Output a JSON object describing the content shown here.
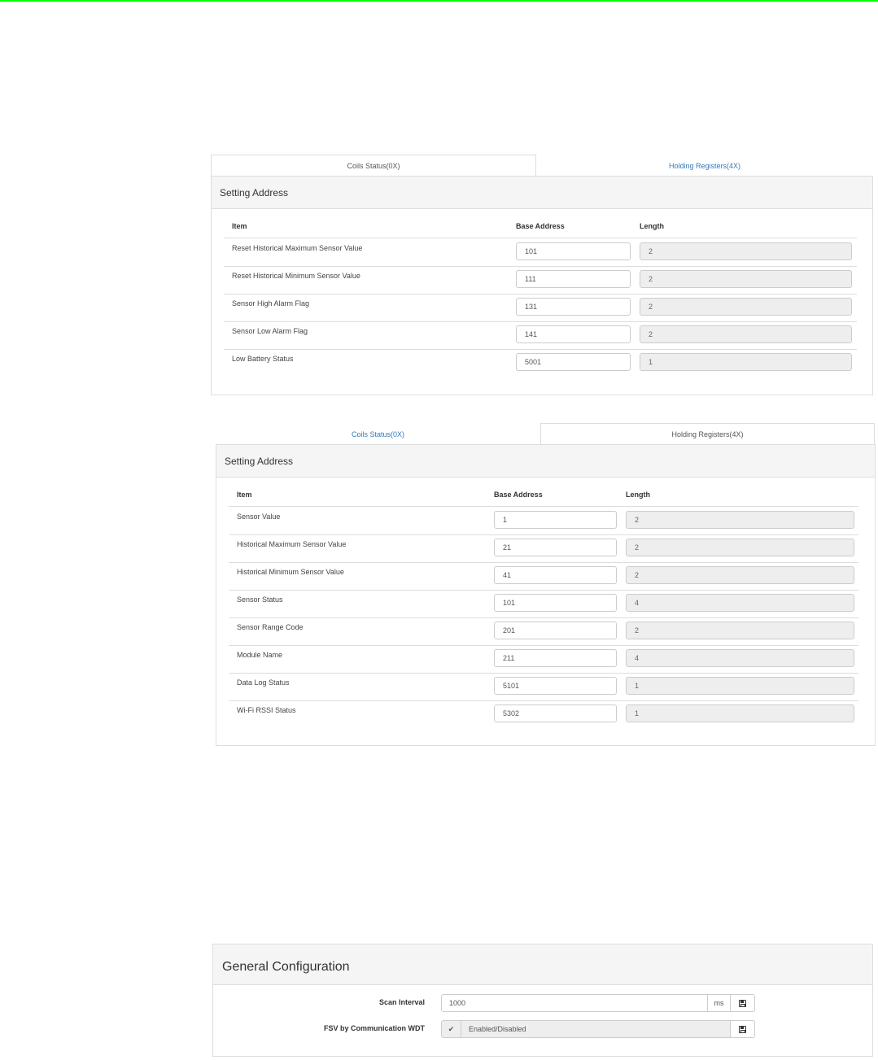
{
  "coils_view": {
    "tabs": [
      {
        "label": "Coils Status(0X)",
        "active": true
      },
      {
        "label": "Holding Registers(4X)",
        "active": false
      }
    ],
    "panel_title": "Setting Address",
    "columns": {
      "item": "Item",
      "base_address": "Base Address",
      "length": "Length"
    },
    "rows": [
      {
        "item": "Reset Historical Maximum Sensor Value",
        "base_address": "101",
        "length": "2"
      },
      {
        "item": "Reset Historical Minimum Sensor Value",
        "base_address": "111",
        "length": "2"
      },
      {
        "item": "Sensor High Alarm Flag",
        "base_address": "131",
        "length": "2"
      },
      {
        "item": "Sensor Low Alarm Flag",
        "base_address": "141",
        "length": "2"
      },
      {
        "item": "Low Battery Status",
        "base_address": "5001",
        "length": "1"
      }
    ]
  },
  "holding_view": {
    "tabs": [
      {
        "label": "Coils Status(0X)",
        "active": false
      },
      {
        "label": "Holding Registers(4X)",
        "active": true
      }
    ],
    "panel_title": "Setting Address",
    "columns": {
      "item": "Item",
      "base_address": "Base Address",
      "length": "Length"
    },
    "rows": [
      {
        "item": "Sensor Value",
        "base_address": "1",
        "length": "2"
      },
      {
        "item": "Historical Maximum Sensor Value",
        "base_address": "21",
        "length": "2"
      },
      {
        "item": "Historical Minimum Sensor Value",
        "base_address": "41",
        "length": "2"
      },
      {
        "item": "Sensor Status",
        "base_address": "101",
        "length": "4"
      },
      {
        "item": "Sensor Range Code",
        "base_address": "201",
        "length": "2"
      },
      {
        "item": "Module Name",
        "base_address": "211",
        "length": "4"
      },
      {
        "item": "Data Log Status",
        "base_address": "5101",
        "length": "1"
      },
      {
        "item": "Wi-Fi RSSI Status",
        "base_address": "5302",
        "length": "1"
      }
    ]
  },
  "general_config": {
    "title": "General Configuration",
    "scan_interval": {
      "label": "Scan Interval",
      "value": "1000",
      "unit": "ms",
      "save_icon": "save-icon"
    },
    "fsv_wdt": {
      "label": "FSV by Communication WDT",
      "checked": true,
      "value": "Enabled/Disabled",
      "save_icon": "save-icon"
    }
  },
  "colors": {
    "accent_line": "#00ff00",
    "link": "#337ab7",
    "panel_heading_bg": "#f5f5f5",
    "readonly_bg": "#eeeeee"
  }
}
